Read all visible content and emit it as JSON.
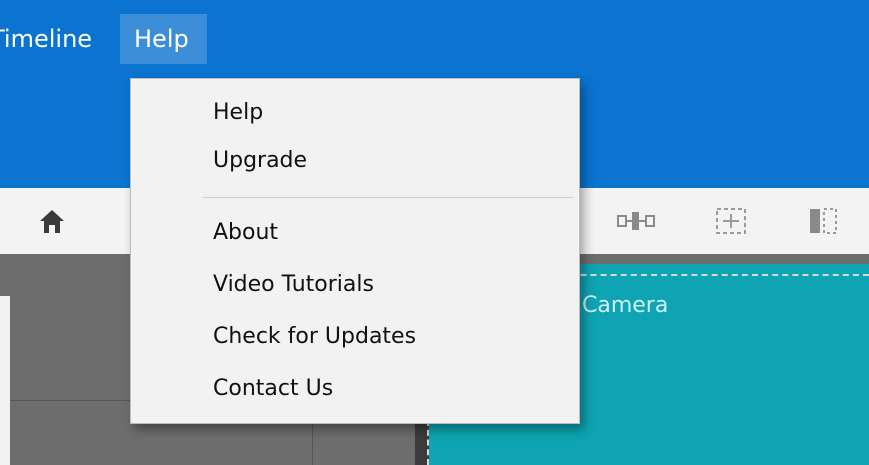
{
  "menubar": {
    "timeline_label": "Timeline",
    "help_label": "Help"
  },
  "help_menu": {
    "items": [
      {
        "label": "Help"
      },
      {
        "label": "Upgrade"
      },
      {
        "label": "About"
      },
      {
        "label": "Video Tutorials"
      },
      {
        "label": "Check for Updates"
      },
      {
        "label": "Contact Us"
      }
    ]
  },
  "canvas": {
    "label": "Camera"
  },
  "colors": {
    "menubar": "#0a74d0",
    "menubar_active": "#3d8ed8",
    "canvas": "#0ea4b3"
  },
  "icons": [
    "home-icon",
    "split-track-icon",
    "fit-frame-icon",
    "align-icon"
  ]
}
